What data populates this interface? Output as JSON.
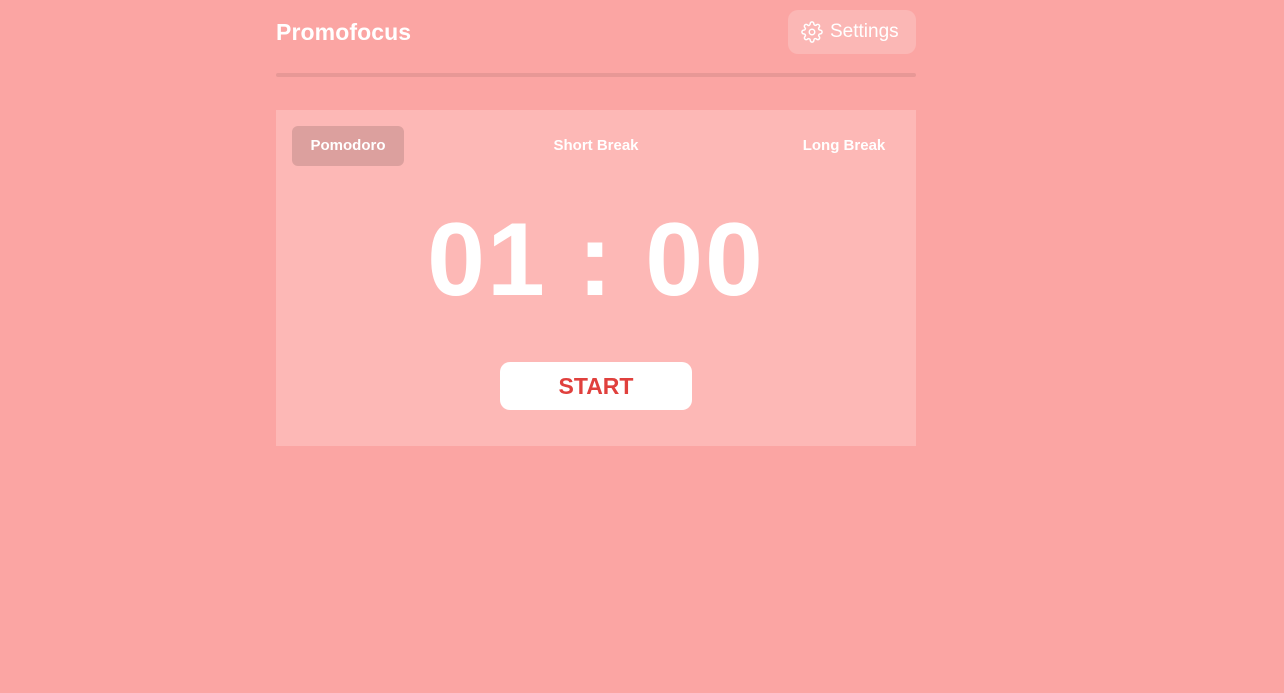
{
  "header": {
    "brand": "Promofocus",
    "settings_label": "Settings",
    "settings_icon": "gear-icon"
  },
  "progress": {
    "fraction": 0
  },
  "timer_card": {
    "tabs": [
      {
        "label": "Pomodoro",
        "active": true
      },
      {
        "label": "Short Break",
        "active": false
      },
      {
        "label": "Long Break",
        "active": false
      }
    ],
    "time": "01 : 00",
    "start_label": "START"
  },
  "colors": {
    "background": "#fba5a3",
    "card": "#fdb8b6",
    "accent": "#e0403d",
    "text": "#ffffff"
  }
}
